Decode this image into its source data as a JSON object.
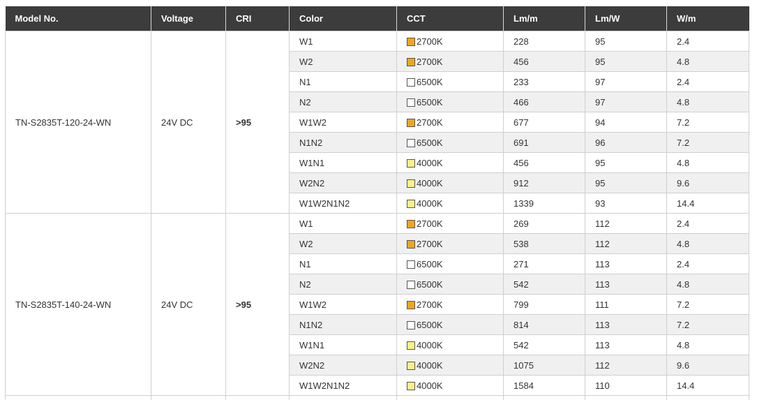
{
  "headers": [
    "Model No.",
    "Voltage",
    "CRI",
    "Color",
    "CCT",
    "Lm/m",
    "Lm/W",
    "W/m"
  ],
  "swatch_colors": {
    "2700K": "#f2a51d",
    "6500K": "#ffffff",
    "4000K": "#fdf08a"
  },
  "groups": [
    {
      "model": "TN-S2835T-120-24-WN",
      "voltage": "24V DC",
      "cri": ">95",
      "rows": [
        {
          "color": "W1",
          "cct": "2700K",
          "lmm": "228",
          "lmw": "95",
          "wm": "2.4"
        },
        {
          "color": "W2",
          "cct": "2700K",
          "lmm": "456",
          "lmw": "95",
          "wm": "4.8"
        },
        {
          "color": "N1",
          "cct": "6500K",
          "lmm": "233",
          "lmw": "97",
          "wm": "2.4"
        },
        {
          "color": "N2",
          "cct": "6500K",
          "lmm": "466",
          "lmw": "97",
          "wm": "4.8"
        },
        {
          "color": "W1W2",
          "cct": "2700K",
          "lmm": "677",
          "lmw": "94",
          "wm": "7.2"
        },
        {
          "color": "N1N2",
          "cct": "6500K",
          "lmm": "691",
          "lmw": "96",
          "wm": "7.2"
        },
        {
          "color": "W1N1",
          "cct": "4000K",
          "lmm": "456",
          "lmw": "95",
          "wm": "4.8"
        },
        {
          "color": "W2N2",
          "cct": "4000K",
          "lmm": "912",
          "lmw": "95",
          "wm": "9.6"
        },
        {
          "color": "W1W2N1N2",
          "cct": "4000K",
          "lmm": "1339",
          "lmw": "93",
          "wm": "14.4"
        }
      ]
    },
    {
      "model": "TN-S2835T-140-24-WN",
      "voltage": "24V DC",
      "cri": ">95",
      "rows": [
        {
          "color": "W1",
          "cct": "2700K",
          "lmm": "269",
          "lmw": "112",
          "wm": "2.4"
        },
        {
          "color": "W2",
          "cct": "2700K",
          "lmm": "538",
          "lmw": "112",
          "wm": "4.8"
        },
        {
          "color": "N1",
          "cct": "6500K",
          "lmm": "271",
          "lmw": "113",
          "wm": "2.4"
        },
        {
          "color": "N2",
          "cct": "6500K",
          "lmm": "542",
          "lmw": "113",
          "wm": "4.8"
        },
        {
          "color": "W1W2",
          "cct": "2700K",
          "lmm": "799",
          "lmw": "111",
          "wm": "7.2"
        },
        {
          "color": "N1N2",
          "cct": "6500K",
          "lmm": "814",
          "lmw": "113",
          "wm": "7.2"
        },
        {
          "color": "W1N1",
          "cct": "4000K",
          "lmm": "542",
          "lmw": "113",
          "wm": "4.8"
        },
        {
          "color": "W2N2",
          "cct": "4000K",
          "lmm": "1075",
          "lmw": "112",
          "wm": "9.6"
        },
        {
          "color": "W1W2N1N2",
          "cct": "4000K",
          "lmm": "1584",
          "lmw": "110",
          "wm": "14.4"
        }
      ]
    }
  ]
}
